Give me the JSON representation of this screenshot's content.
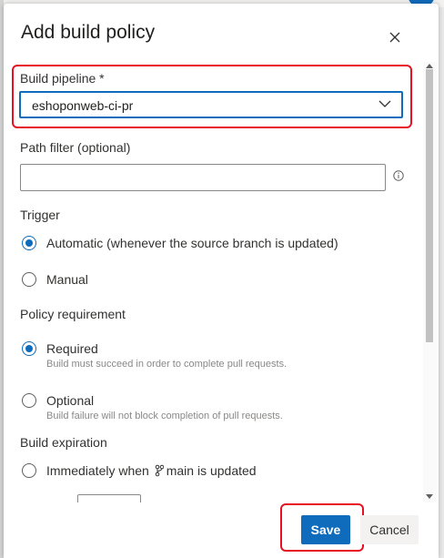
{
  "dialog": {
    "title": "Add build policy",
    "close_icon": "close-icon"
  },
  "build_pipeline": {
    "label": "Build pipeline *",
    "value": "eshoponweb-ci-pr",
    "dropdown_icon": "chevron-down-icon"
  },
  "path_filter": {
    "label": "Path filter (optional)",
    "value": "",
    "info_icon": "info-icon"
  },
  "trigger": {
    "label": "Trigger",
    "options": [
      {
        "label": "Automatic (whenever the source branch is updated)",
        "checked": true
      },
      {
        "label": "Manual",
        "checked": false
      }
    ]
  },
  "policy_requirement": {
    "label": "Policy requirement",
    "options": [
      {
        "label": "Required",
        "description": "Build must succeed in order to complete pull requests.",
        "checked": true
      },
      {
        "label": "Optional",
        "description": "Build failure will not block completion of pull requests.",
        "checked": false
      }
    ]
  },
  "build_expiration": {
    "label": "Build expiration",
    "options": [
      {
        "label_prefix": "Immediately when",
        "branch": "main",
        "label_suffix": "is updated",
        "checked": false,
        "branch_icon": "branch-icon"
      }
    ]
  },
  "footer": {
    "save_label": "Save",
    "cancel_label": "Cancel"
  },
  "colors": {
    "accent": "#0f6cbd",
    "highlight": "#e81123"
  }
}
